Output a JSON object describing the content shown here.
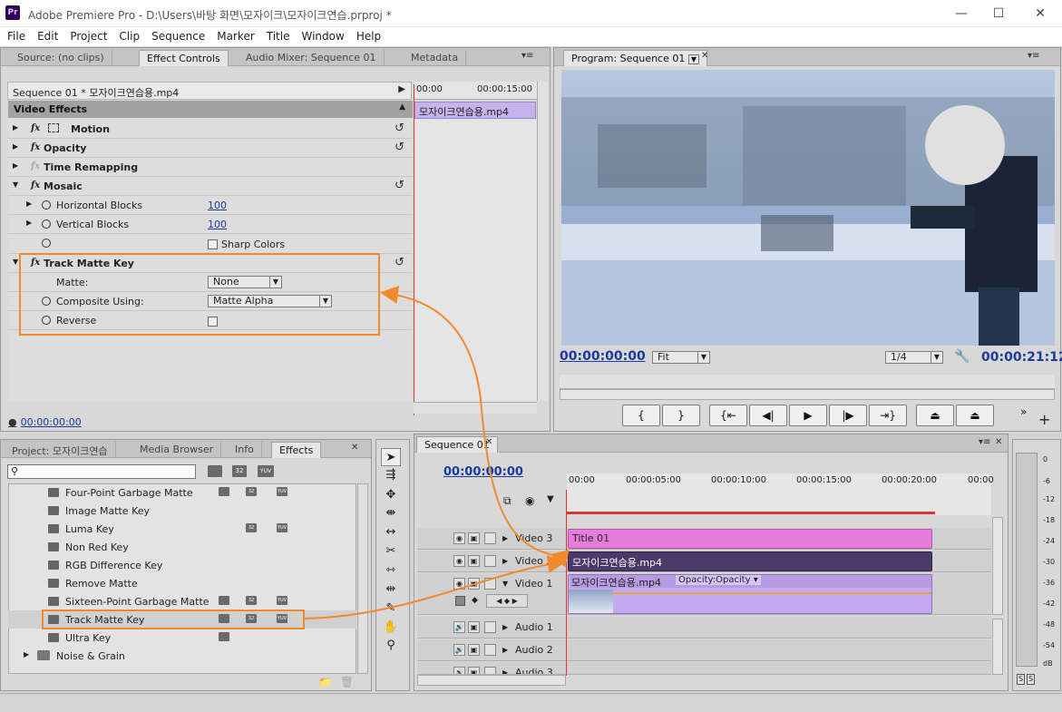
{
  "window": {
    "title": "Adobe Premiere Pro - D:\\Users\\바탕 화면\\모자이크\\모자이크연습.prproj *",
    "logo": "Pr"
  },
  "menu": [
    "File",
    "Edit",
    "Project",
    "Clip",
    "Sequence",
    "Marker",
    "Title",
    "Window",
    "Help"
  ],
  "source_panel": {
    "tabs": [
      "Source: (no clips)",
      "Effect Controls",
      "Audio Mixer: Sequence 01",
      "Metadata"
    ],
    "sequence_label": "Sequence 01 * 모자이크연습용.mp4",
    "time_start": "00:00",
    "time_end": "00:00:15:00",
    "clip_label": "모자이크연습용.mp4",
    "section": "Video Effects",
    "effects": [
      {
        "name": "Motion"
      },
      {
        "name": "Opacity"
      },
      {
        "name": "Time Remapping"
      },
      {
        "name": "Mosaic"
      }
    ],
    "mosaic_params": [
      {
        "name": "Horizontal Blocks",
        "value": "100"
      },
      {
        "name": "Vertical Blocks",
        "value": "100"
      },
      {
        "name": "Sharp Colors"
      }
    ],
    "track_matte": {
      "name": "Track Matte Key",
      "matte_label": "Matte:",
      "matte_value": "None",
      "composite_label": "Composite Using:",
      "composite_value": "Matte Alpha",
      "reverse_label": "Reverse"
    },
    "timecode": "00:00:00:00"
  },
  "program_panel": {
    "tab": "Program: Sequence 01",
    "timecode": "00:00:00:00",
    "fit": "Fit",
    "quality": "1/4",
    "duration": "00:00:21:12"
  },
  "project_panel": {
    "tabs": [
      "Project: 모자이크연습",
      "Media Browser",
      "Info",
      "Effects"
    ],
    "search_value": "",
    "badges": [
      "32",
      "YUV"
    ],
    "items": [
      "Four-Point Garbage Matte",
      "Image Matte Key",
      "Luma Key",
      "Non Red Key",
      "RGB Difference Key",
      "Remove Matte",
      "Sixteen-Point Garbage Matte",
      "Track Matte Key",
      "Ultra Key"
    ],
    "folders": [
      "Noise & Grain"
    ]
  },
  "timeline": {
    "tab": "Sequence 01",
    "timecode": "00:00:00:00",
    "ruler": [
      "00:00",
      "00:00:05:00",
      "00:00:10:00",
      "00:00:15:00",
      "00:00:20:00",
      "00:00"
    ],
    "video_tracks": [
      {
        "name": "Video 3",
        "clip": "Title 01",
        "color": "#e67ddd"
      },
      {
        "name": "Video 2",
        "clip": "모자이크연습용.mp4",
        "color": "#4a3a6a"
      },
      {
        "name": "Video 1",
        "clip": "모자이크연습용.mp4",
        "fx": "Opacity:Opacity",
        "color": "#b69be0"
      }
    ],
    "audio_tracks": [
      "Audio 1",
      "Audio 2",
      "Audio 3"
    ]
  },
  "meter": {
    "labels": [
      "0",
      "-6",
      "-12",
      "-18",
      "-24",
      "-30",
      "-36",
      "-42",
      "-48",
      "-54",
      "dB"
    ],
    "solo": [
      "S",
      "S"
    ]
  }
}
